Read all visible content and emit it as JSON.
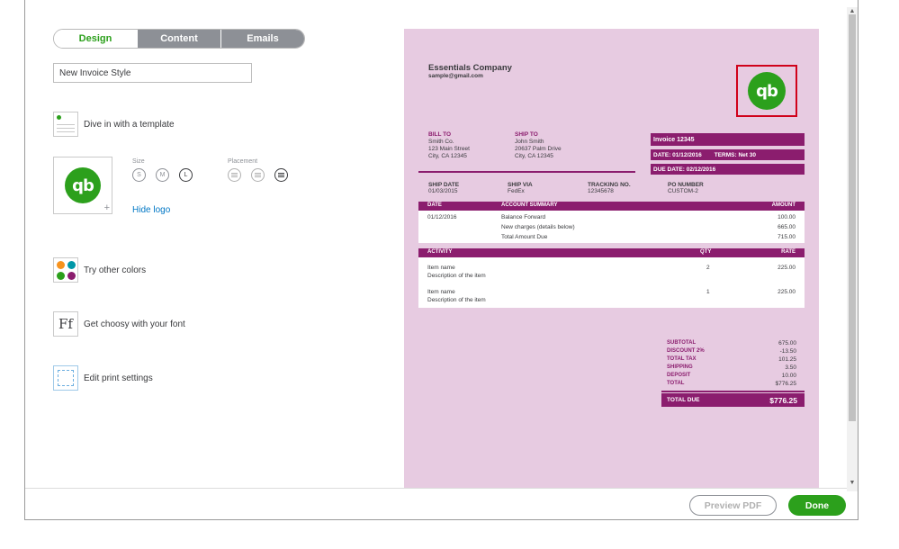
{
  "tabs": [
    {
      "label": "Design",
      "active": true
    },
    {
      "label": "Content",
      "active": false
    },
    {
      "label": "Emails",
      "active": false
    }
  ],
  "style_name": {
    "value": "New Invoice Style"
  },
  "options": {
    "template": "Dive in with a template",
    "colors": "Try other colors",
    "font": "Get choosy with your font",
    "print": "Edit print settings"
  },
  "logo": {
    "size_label": "Size",
    "sizes": [
      "S",
      "M",
      "L"
    ],
    "selected_size": "L",
    "placement_label": "Placement",
    "selected_placement": "right",
    "hide_logo": "Hide logo",
    "plus": "+",
    "mark": "qb"
  },
  "invoice": {
    "company": "Essentials Company",
    "email": "sample@gmail.com",
    "bill_to_label": "BILL TO",
    "bill_to": [
      "Smith Co.",
      "123 Main Street",
      "City, CA 12345"
    ],
    "ship_to_label": "SHIP TO",
    "ship_to": [
      "John Smith",
      "20637 Palm Drive",
      "City, CA 12345"
    ],
    "invoice_no": "Invoice  12345",
    "date_line": "DATE:  01/12/2016",
    "terms": "TERMS:  Net 30",
    "due_date": "DUE DATE:  02/12/2016",
    "ship_info": [
      {
        "label": "SHIP DATE",
        "value": "01/03/2015"
      },
      {
        "label": "SHIP VIA",
        "value": "FedEx"
      },
      {
        "label": "TRACKING NO.",
        "value": "12345678"
      },
      {
        "label": "PO NUMBER",
        "value": "CUSTOM-2"
      }
    ],
    "account_headers": {
      "date": "DATE",
      "summary": "ACCOUNT SUMMARY",
      "amount": "AMOUNT"
    },
    "account_rows": [
      {
        "date": "01/12/2016",
        "desc": "Balance Forward",
        "amount": "100.00"
      },
      {
        "date": "",
        "desc": "New charges (details below)",
        "amount": "665.00"
      },
      {
        "date": "",
        "desc": "Total Amount Due",
        "amount": "715.00"
      }
    ],
    "activity_headers": {
      "activity": "ACTIVITY",
      "qty": "QTY",
      "rate": "RATE"
    },
    "activity_rows": [
      {
        "name": "Item name",
        "desc": "Description of the item",
        "qty": "2",
        "rate": "225.00"
      },
      {
        "name": "Item name",
        "desc": "Description of the item",
        "qty": "1",
        "rate": "225.00"
      }
    ],
    "totals": [
      {
        "label": "SUBTOTAL",
        "value": "675.00"
      },
      {
        "label": "DISCOUNT 2%",
        "value": "-13.50"
      },
      {
        "label": "TOTAL TAX",
        "value": "101.25"
      },
      {
        "label": "SHIPPING",
        "value": "3.50"
      },
      {
        "label": "DEPOSIT",
        "value": "10.00"
      },
      {
        "label": "TOTAL",
        "value": "$776.25"
      }
    ],
    "total_due_label": "TOTAL DUE",
    "total_due_value": "$776.25"
  },
  "footer": {
    "preview_pdf": "Preview PDF",
    "done": "Done"
  },
  "colors": {
    "accent": "#2ca01c",
    "invoice_theme": "#8b1d6e",
    "preview_bg": "#e7cbe1",
    "link": "#0077c5",
    "selection": "#d0021b"
  }
}
